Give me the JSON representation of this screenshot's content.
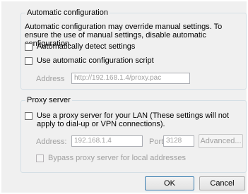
{
  "automatic": {
    "legend": "Automatic configuration",
    "description": "Automatic configuration may override manual settings.  To ensure the use of manual settings, disable automatic configuration.",
    "detect_label": "Automatically detect settings",
    "detect_checked": false,
    "script_label": "Use automatic configuration script",
    "script_checked": false,
    "address_label": "Address",
    "address_value": "http://192.168.1.4/proxy.pac"
  },
  "proxy": {
    "legend": "Proxy server",
    "use_proxy_label": "Use a proxy server for your LAN (These settings will not apply to dial-up or VPN connections).",
    "use_proxy_checked": false,
    "address_label": "Address:",
    "address_value": "192.168.1.4",
    "port_label": "Port:",
    "port_value": "3128",
    "advanced_label": "Advanced...",
    "bypass_label": "Bypass proxy server for local addresses"
  },
  "buttons": {
    "ok": "OK",
    "cancel": "Cancel"
  }
}
